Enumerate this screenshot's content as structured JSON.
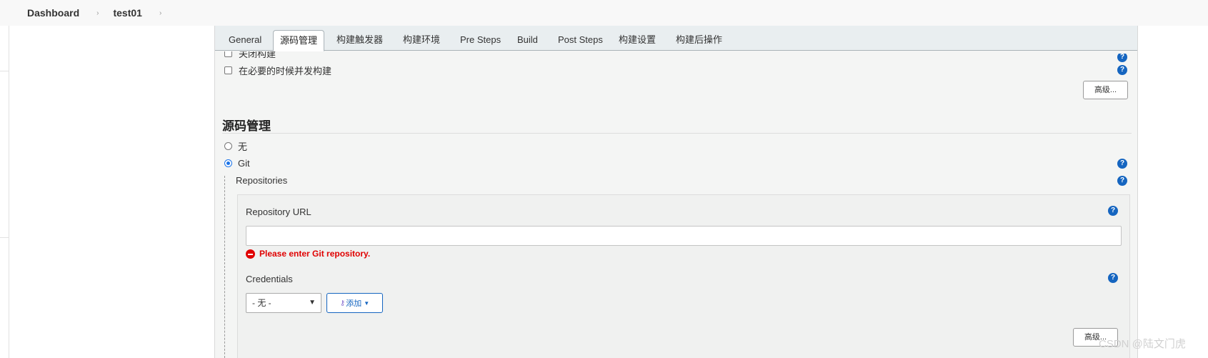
{
  "breadcrumb": {
    "items": [
      "Dashboard",
      "test01"
    ],
    "separator": "›"
  },
  "tabs": [
    {
      "label": "General",
      "active": false
    },
    {
      "label": "源码管理",
      "active": true
    },
    {
      "label": "构建触发器",
      "active": false
    },
    {
      "label": "构建环境",
      "active": false
    },
    {
      "label": "Pre Steps",
      "active": false
    },
    {
      "label": "Build",
      "active": false
    },
    {
      "label": "Post Steps",
      "active": false
    },
    {
      "label": "构建设置",
      "active": false
    },
    {
      "label": "构建后操作",
      "active": false
    }
  ],
  "general": {
    "disable_build": "关闭构建",
    "concurrent_build": "在必要的时候并发构建",
    "advanced_button": "高级..."
  },
  "scm": {
    "title": "源码管理",
    "option_none": "无",
    "option_git": "Git",
    "selected": "Git",
    "repositories_label": "Repositories",
    "repo_url_label": "Repository URL",
    "repo_url_value": "",
    "repo_url_error": "Please enter Git repository.",
    "credentials_label": "Credentials",
    "credentials_selected": "- 无 -",
    "add_button": "添加",
    "advanced_button": "高级..."
  },
  "help_icon": "?",
  "watermark": "CSDN @陆文门虎",
  "colors": {
    "accent": "#1565c0",
    "error": "#e00000",
    "tabbar": "#e9eef0",
    "panel": "#f4f5f4"
  }
}
